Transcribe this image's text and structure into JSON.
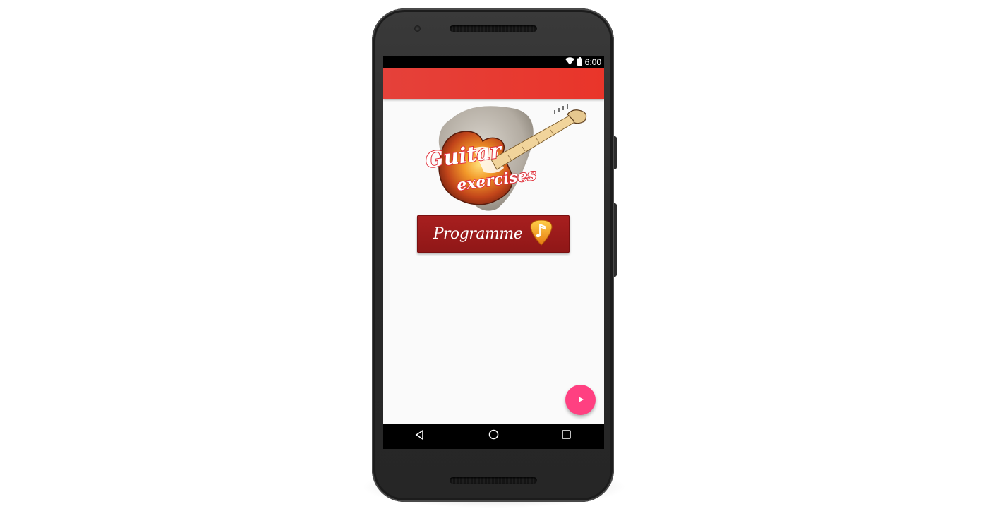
{
  "status_bar": {
    "time": "6:00",
    "icons": [
      "wifi-icon",
      "battery-icon"
    ]
  },
  "logo": {
    "line1": "Guitar",
    "line2": "exercises"
  },
  "main": {
    "programme_label": "Programme",
    "programme_icon": "guitar-pick-note-icon"
  },
  "fab": {
    "icon": "play-icon"
  },
  "nav_bar": {
    "items": [
      "back-icon",
      "home-icon",
      "recents-icon"
    ]
  },
  "colors": {
    "app_bar": "#e9352a",
    "button": "#9d1b1b",
    "fab": "#ff4081",
    "background": "#fafafa"
  }
}
